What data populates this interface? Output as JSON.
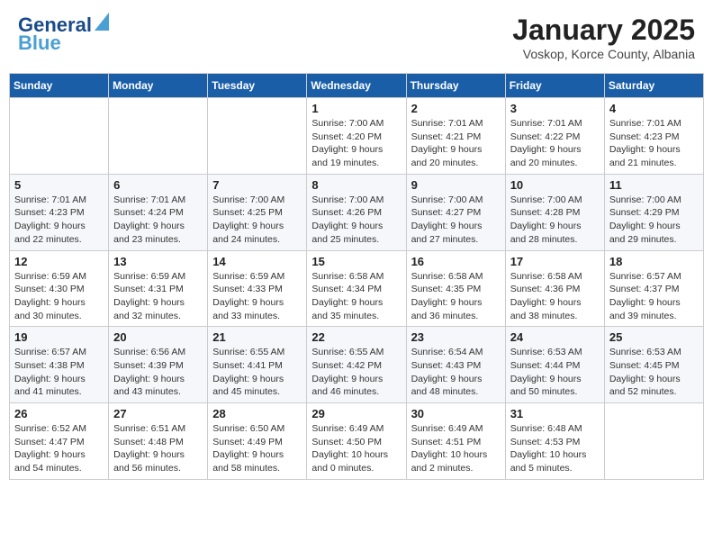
{
  "header": {
    "logo_line1": "General",
    "logo_line2": "Blue",
    "month": "January 2025",
    "location": "Voskop, Korce County, Albania"
  },
  "weekdays": [
    "Sunday",
    "Monday",
    "Tuesday",
    "Wednesday",
    "Thursday",
    "Friday",
    "Saturday"
  ],
  "weeks": [
    [
      {
        "day": "",
        "sunrise": "",
        "sunset": "",
        "daylight": ""
      },
      {
        "day": "",
        "sunrise": "",
        "sunset": "",
        "daylight": ""
      },
      {
        "day": "",
        "sunrise": "",
        "sunset": "",
        "daylight": ""
      },
      {
        "day": "1",
        "sunrise": "Sunrise: 7:00 AM",
        "sunset": "Sunset: 4:20 PM",
        "daylight": "Daylight: 9 hours and 19 minutes."
      },
      {
        "day": "2",
        "sunrise": "Sunrise: 7:01 AM",
        "sunset": "Sunset: 4:21 PM",
        "daylight": "Daylight: 9 hours and 20 minutes."
      },
      {
        "day": "3",
        "sunrise": "Sunrise: 7:01 AM",
        "sunset": "Sunset: 4:22 PM",
        "daylight": "Daylight: 9 hours and 20 minutes."
      },
      {
        "day": "4",
        "sunrise": "Sunrise: 7:01 AM",
        "sunset": "Sunset: 4:23 PM",
        "daylight": "Daylight: 9 hours and 21 minutes."
      }
    ],
    [
      {
        "day": "5",
        "sunrise": "Sunrise: 7:01 AM",
        "sunset": "Sunset: 4:23 PM",
        "daylight": "Daylight: 9 hours and 22 minutes."
      },
      {
        "day": "6",
        "sunrise": "Sunrise: 7:01 AM",
        "sunset": "Sunset: 4:24 PM",
        "daylight": "Daylight: 9 hours and 23 minutes."
      },
      {
        "day": "7",
        "sunrise": "Sunrise: 7:00 AM",
        "sunset": "Sunset: 4:25 PM",
        "daylight": "Daylight: 9 hours and 24 minutes."
      },
      {
        "day": "8",
        "sunrise": "Sunrise: 7:00 AM",
        "sunset": "Sunset: 4:26 PM",
        "daylight": "Daylight: 9 hours and 25 minutes."
      },
      {
        "day": "9",
        "sunrise": "Sunrise: 7:00 AM",
        "sunset": "Sunset: 4:27 PM",
        "daylight": "Daylight: 9 hours and 27 minutes."
      },
      {
        "day": "10",
        "sunrise": "Sunrise: 7:00 AM",
        "sunset": "Sunset: 4:28 PM",
        "daylight": "Daylight: 9 hours and 28 minutes."
      },
      {
        "day": "11",
        "sunrise": "Sunrise: 7:00 AM",
        "sunset": "Sunset: 4:29 PM",
        "daylight": "Daylight: 9 hours and 29 minutes."
      }
    ],
    [
      {
        "day": "12",
        "sunrise": "Sunrise: 6:59 AM",
        "sunset": "Sunset: 4:30 PM",
        "daylight": "Daylight: 9 hours and 30 minutes."
      },
      {
        "day": "13",
        "sunrise": "Sunrise: 6:59 AM",
        "sunset": "Sunset: 4:31 PM",
        "daylight": "Daylight: 9 hours and 32 minutes."
      },
      {
        "day": "14",
        "sunrise": "Sunrise: 6:59 AM",
        "sunset": "Sunset: 4:33 PM",
        "daylight": "Daylight: 9 hours and 33 minutes."
      },
      {
        "day": "15",
        "sunrise": "Sunrise: 6:58 AM",
        "sunset": "Sunset: 4:34 PM",
        "daylight": "Daylight: 9 hours and 35 minutes."
      },
      {
        "day": "16",
        "sunrise": "Sunrise: 6:58 AM",
        "sunset": "Sunset: 4:35 PM",
        "daylight": "Daylight: 9 hours and 36 minutes."
      },
      {
        "day": "17",
        "sunrise": "Sunrise: 6:58 AM",
        "sunset": "Sunset: 4:36 PM",
        "daylight": "Daylight: 9 hours and 38 minutes."
      },
      {
        "day": "18",
        "sunrise": "Sunrise: 6:57 AM",
        "sunset": "Sunset: 4:37 PM",
        "daylight": "Daylight: 9 hours and 39 minutes."
      }
    ],
    [
      {
        "day": "19",
        "sunrise": "Sunrise: 6:57 AM",
        "sunset": "Sunset: 4:38 PM",
        "daylight": "Daylight: 9 hours and 41 minutes."
      },
      {
        "day": "20",
        "sunrise": "Sunrise: 6:56 AM",
        "sunset": "Sunset: 4:39 PM",
        "daylight": "Daylight: 9 hours and 43 minutes."
      },
      {
        "day": "21",
        "sunrise": "Sunrise: 6:55 AM",
        "sunset": "Sunset: 4:41 PM",
        "daylight": "Daylight: 9 hours and 45 minutes."
      },
      {
        "day": "22",
        "sunrise": "Sunrise: 6:55 AM",
        "sunset": "Sunset: 4:42 PM",
        "daylight": "Daylight: 9 hours and 46 minutes."
      },
      {
        "day": "23",
        "sunrise": "Sunrise: 6:54 AM",
        "sunset": "Sunset: 4:43 PM",
        "daylight": "Daylight: 9 hours and 48 minutes."
      },
      {
        "day": "24",
        "sunrise": "Sunrise: 6:53 AM",
        "sunset": "Sunset: 4:44 PM",
        "daylight": "Daylight: 9 hours and 50 minutes."
      },
      {
        "day": "25",
        "sunrise": "Sunrise: 6:53 AM",
        "sunset": "Sunset: 4:45 PM",
        "daylight": "Daylight: 9 hours and 52 minutes."
      }
    ],
    [
      {
        "day": "26",
        "sunrise": "Sunrise: 6:52 AM",
        "sunset": "Sunset: 4:47 PM",
        "daylight": "Daylight: 9 hours and 54 minutes."
      },
      {
        "day": "27",
        "sunrise": "Sunrise: 6:51 AM",
        "sunset": "Sunset: 4:48 PM",
        "daylight": "Daylight: 9 hours and 56 minutes."
      },
      {
        "day": "28",
        "sunrise": "Sunrise: 6:50 AM",
        "sunset": "Sunset: 4:49 PM",
        "daylight": "Daylight: 9 hours and 58 minutes."
      },
      {
        "day": "29",
        "sunrise": "Sunrise: 6:49 AM",
        "sunset": "Sunset: 4:50 PM",
        "daylight": "Daylight: 10 hours and 0 minutes."
      },
      {
        "day": "30",
        "sunrise": "Sunrise: 6:49 AM",
        "sunset": "Sunset: 4:51 PM",
        "daylight": "Daylight: 10 hours and 2 minutes."
      },
      {
        "day": "31",
        "sunrise": "Sunrise: 6:48 AM",
        "sunset": "Sunset: 4:53 PM",
        "daylight": "Daylight: 10 hours and 5 minutes."
      },
      {
        "day": "",
        "sunrise": "",
        "sunset": "",
        "daylight": ""
      }
    ]
  ]
}
